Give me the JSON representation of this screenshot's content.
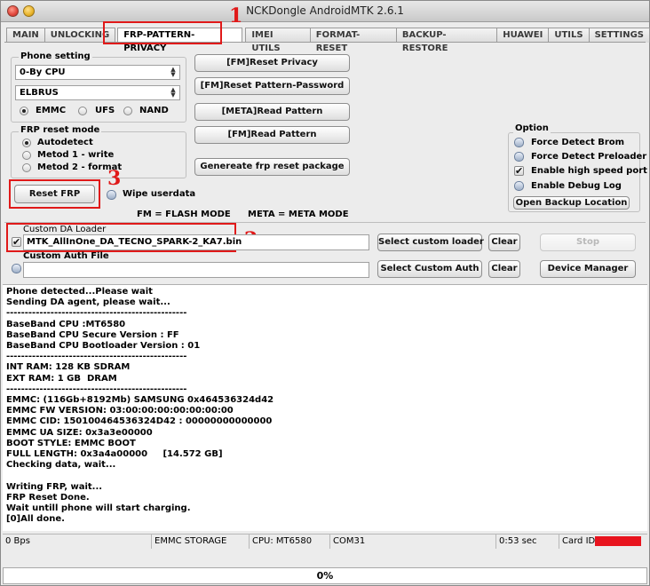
{
  "window": {
    "title": "NCKDongle AndroidMTK 2.6.1"
  },
  "tabs": [
    {
      "label": "MAIN"
    },
    {
      "label": "UNLOCKING"
    },
    {
      "label": "FRP-PATTERN-PRIVACY",
      "active": true
    },
    {
      "label": "IMEI UTILS"
    },
    {
      "label": "FORMAT-RESET"
    },
    {
      "label": "BACKUP-RESTORE"
    },
    {
      "label": "HUAWEI"
    },
    {
      "label": "UTILS"
    },
    {
      "label": "SETTINGS"
    }
  ],
  "annotations": {
    "one": "1",
    "two": "2",
    "three": "3",
    "color": "#e01919"
  },
  "phone_setting": {
    "title": "Phone setting",
    "cpu": "0-By CPU",
    "model": "ELBRUS",
    "storage_options": [
      "EMMC",
      "UFS",
      "NAND"
    ],
    "storage_selected": "EMMC"
  },
  "frp_reset_mode": {
    "title": "FRP reset mode",
    "options": [
      "Autodetect",
      "Metod 1 - write",
      "Metod 2 - format"
    ],
    "selected": "Autodetect"
  },
  "buttons": {
    "reset_privacy": "[FM]Reset Privacy",
    "reset_pattern_password": "[FM]Reset Pattern-Password",
    "meta_read_pattern": "[META]Read Pattern",
    "fm_read_pattern": "[FM]Read Pattern",
    "generate_frp": "Genereate frp reset package",
    "reset_frp": "Reset FRP",
    "select_custom_loader": "Select custom loader",
    "clear_loader": "Clear",
    "stop": "Stop",
    "select_custom_auth": "Select Custom Auth",
    "clear_auth": "Clear",
    "device_manager": "Device Manager",
    "open_backup_location": "Open Backup Location"
  },
  "wipe_userdata": {
    "label": "Wipe userdata",
    "checked": false
  },
  "legend": {
    "fm": "FM = FLASH MODE",
    "meta": "META = META MODE"
  },
  "options": {
    "title": "Option",
    "items": [
      {
        "label": "Force Detect Brom",
        "checked": false
      },
      {
        "label": "Force Detect Preloader",
        "checked": false
      },
      {
        "label": "Enable high speed port",
        "checked": true
      },
      {
        "label": "Enable Debug Log",
        "checked": false
      }
    ]
  },
  "custom_da": {
    "label": "Custom DA Loader",
    "checked": true,
    "value": "MTK_AllInOne_DA_TECNO_SPARK-2_KA7.bin"
  },
  "custom_auth": {
    "label": "Custom Auth File",
    "value": ""
  },
  "log": [
    "Phone detected...Please wait",
    "Sending DA agent, please wait...",
    "-------------------------------------------------",
    "BaseBand CPU :MT6580",
    "BaseBand CPU Secure Version : FF",
    "BaseBand CPU Bootloader Version : 01",
    "-------------------------------------------------",
    "INT RAM: 128 KB SDRAM",
    "EXT RAM: 1 GB  DRAM",
    "-------------------------------------------------",
    "EMMC: (116Gb+8192Mb) SAMSUNG 0x464536324d42",
    "EMMC FW VERSION: 03:00:00:00:00:00:00:00",
    "EMMC CID: 150100464536324D42 : 00000000000000",
    "EMMC UA SIZE: 0x3a3e00000",
    "BOOT STYLE: EMMC BOOT",
    "FULL LENGTH: 0x3a4a00000     [14.572 GB]",
    "Checking data, wait...",
    "",
    "Writing FRP, wait...",
    "FRP Reset Done.",
    "Wait untill phone will start charging.",
    "[0]All done."
  ],
  "status": {
    "speed": "0 Bps",
    "storage": "EMMC STORAGE",
    "cpu": "CPU: MT6580",
    "port": "COM31",
    "time": "0:53 sec",
    "card": "Card ID:",
    "card_redact_color": "#e8141e"
  },
  "progress": {
    "text": "0%",
    "value": 0
  }
}
